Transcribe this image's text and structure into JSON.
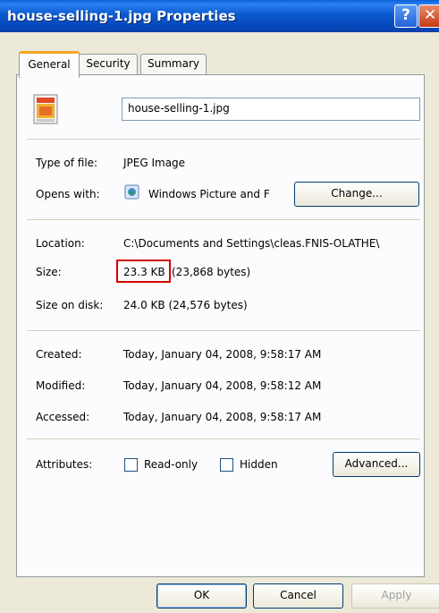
{
  "window": {
    "title": "house-selling-1.jpg Properties",
    "help_glyph": "?",
    "close_glyph": "✕"
  },
  "tabs": [
    {
      "label": "General",
      "active": true
    },
    {
      "label": "Security",
      "active": false
    },
    {
      "label": "Summary",
      "active": false
    }
  ],
  "general": {
    "file_name": "house-selling-1.jpg",
    "type_label": "Type of file:",
    "type_value": "JPEG Image",
    "opens_label": "Opens with:",
    "opens_value": "Windows Picture and F",
    "change_button": "Change...",
    "location_label": "Location:",
    "location_value": "C:\\Documents and Settings\\cleas.FNIS-OLATHE\\",
    "size_label": "Size:",
    "size_value_highlighted": "23.3 KB",
    "size_value_rest": "(23,868 bytes)",
    "size_on_disk_label": "Size on disk:",
    "size_on_disk_value": "24.0 KB (24,576 bytes)",
    "created_label": "Created:",
    "created_value": "Today, January 04, 2008, 9:58:17 AM",
    "modified_label": "Modified:",
    "modified_value": "Today, January 04, 2008, 9:58:12 AM",
    "accessed_label": "Accessed:",
    "accessed_value": "Today, January 04, 2008, 9:58:17 AM",
    "attributes_label": "Attributes:",
    "readonly_label": "Read-only",
    "readonly_checked": false,
    "hidden_label": "Hidden",
    "hidden_checked": false,
    "advanced_button": "Advanced..."
  },
  "footer": {
    "ok": "OK",
    "cancel": "Cancel",
    "apply": "Apply"
  },
  "colors": {
    "highlight": "#d40000",
    "titlebar": "#0a53c8",
    "panel": "#fcfcfe"
  }
}
